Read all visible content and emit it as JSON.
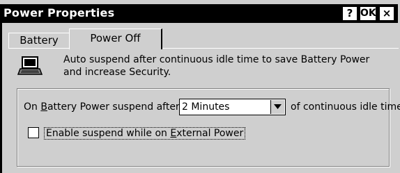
{
  "window": {
    "title": "Power Properties",
    "help_label": "?",
    "ok_label": "OK",
    "close_label": "×"
  },
  "tabs": [
    {
      "label": "Battery",
      "selected": false
    },
    {
      "label": "Power Off",
      "selected": true
    }
  ],
  "description": {
    "line1": "Auto suspend after continuous idle time to save Battery Power",
    "line2": "and increase Security."
  },
  "battery_suspend": {
    "label_prefix": "On ",
    "label_access": "B",
    "label_rest": "attery Power suspend after",
    "selected_value": "2 Minutes",
    "label_after": "of continuous idle time."
  },
  "external_power": {
    "label_prefix": "Enable suspend while on ",
    "label_access": "E",
    "label_rest": "xternal Power",
    "checked": false
  },
  "icons": {
    "description_icon": "laptop-icon",
    "dropdown": "chevron-down-icon"
  }
}
